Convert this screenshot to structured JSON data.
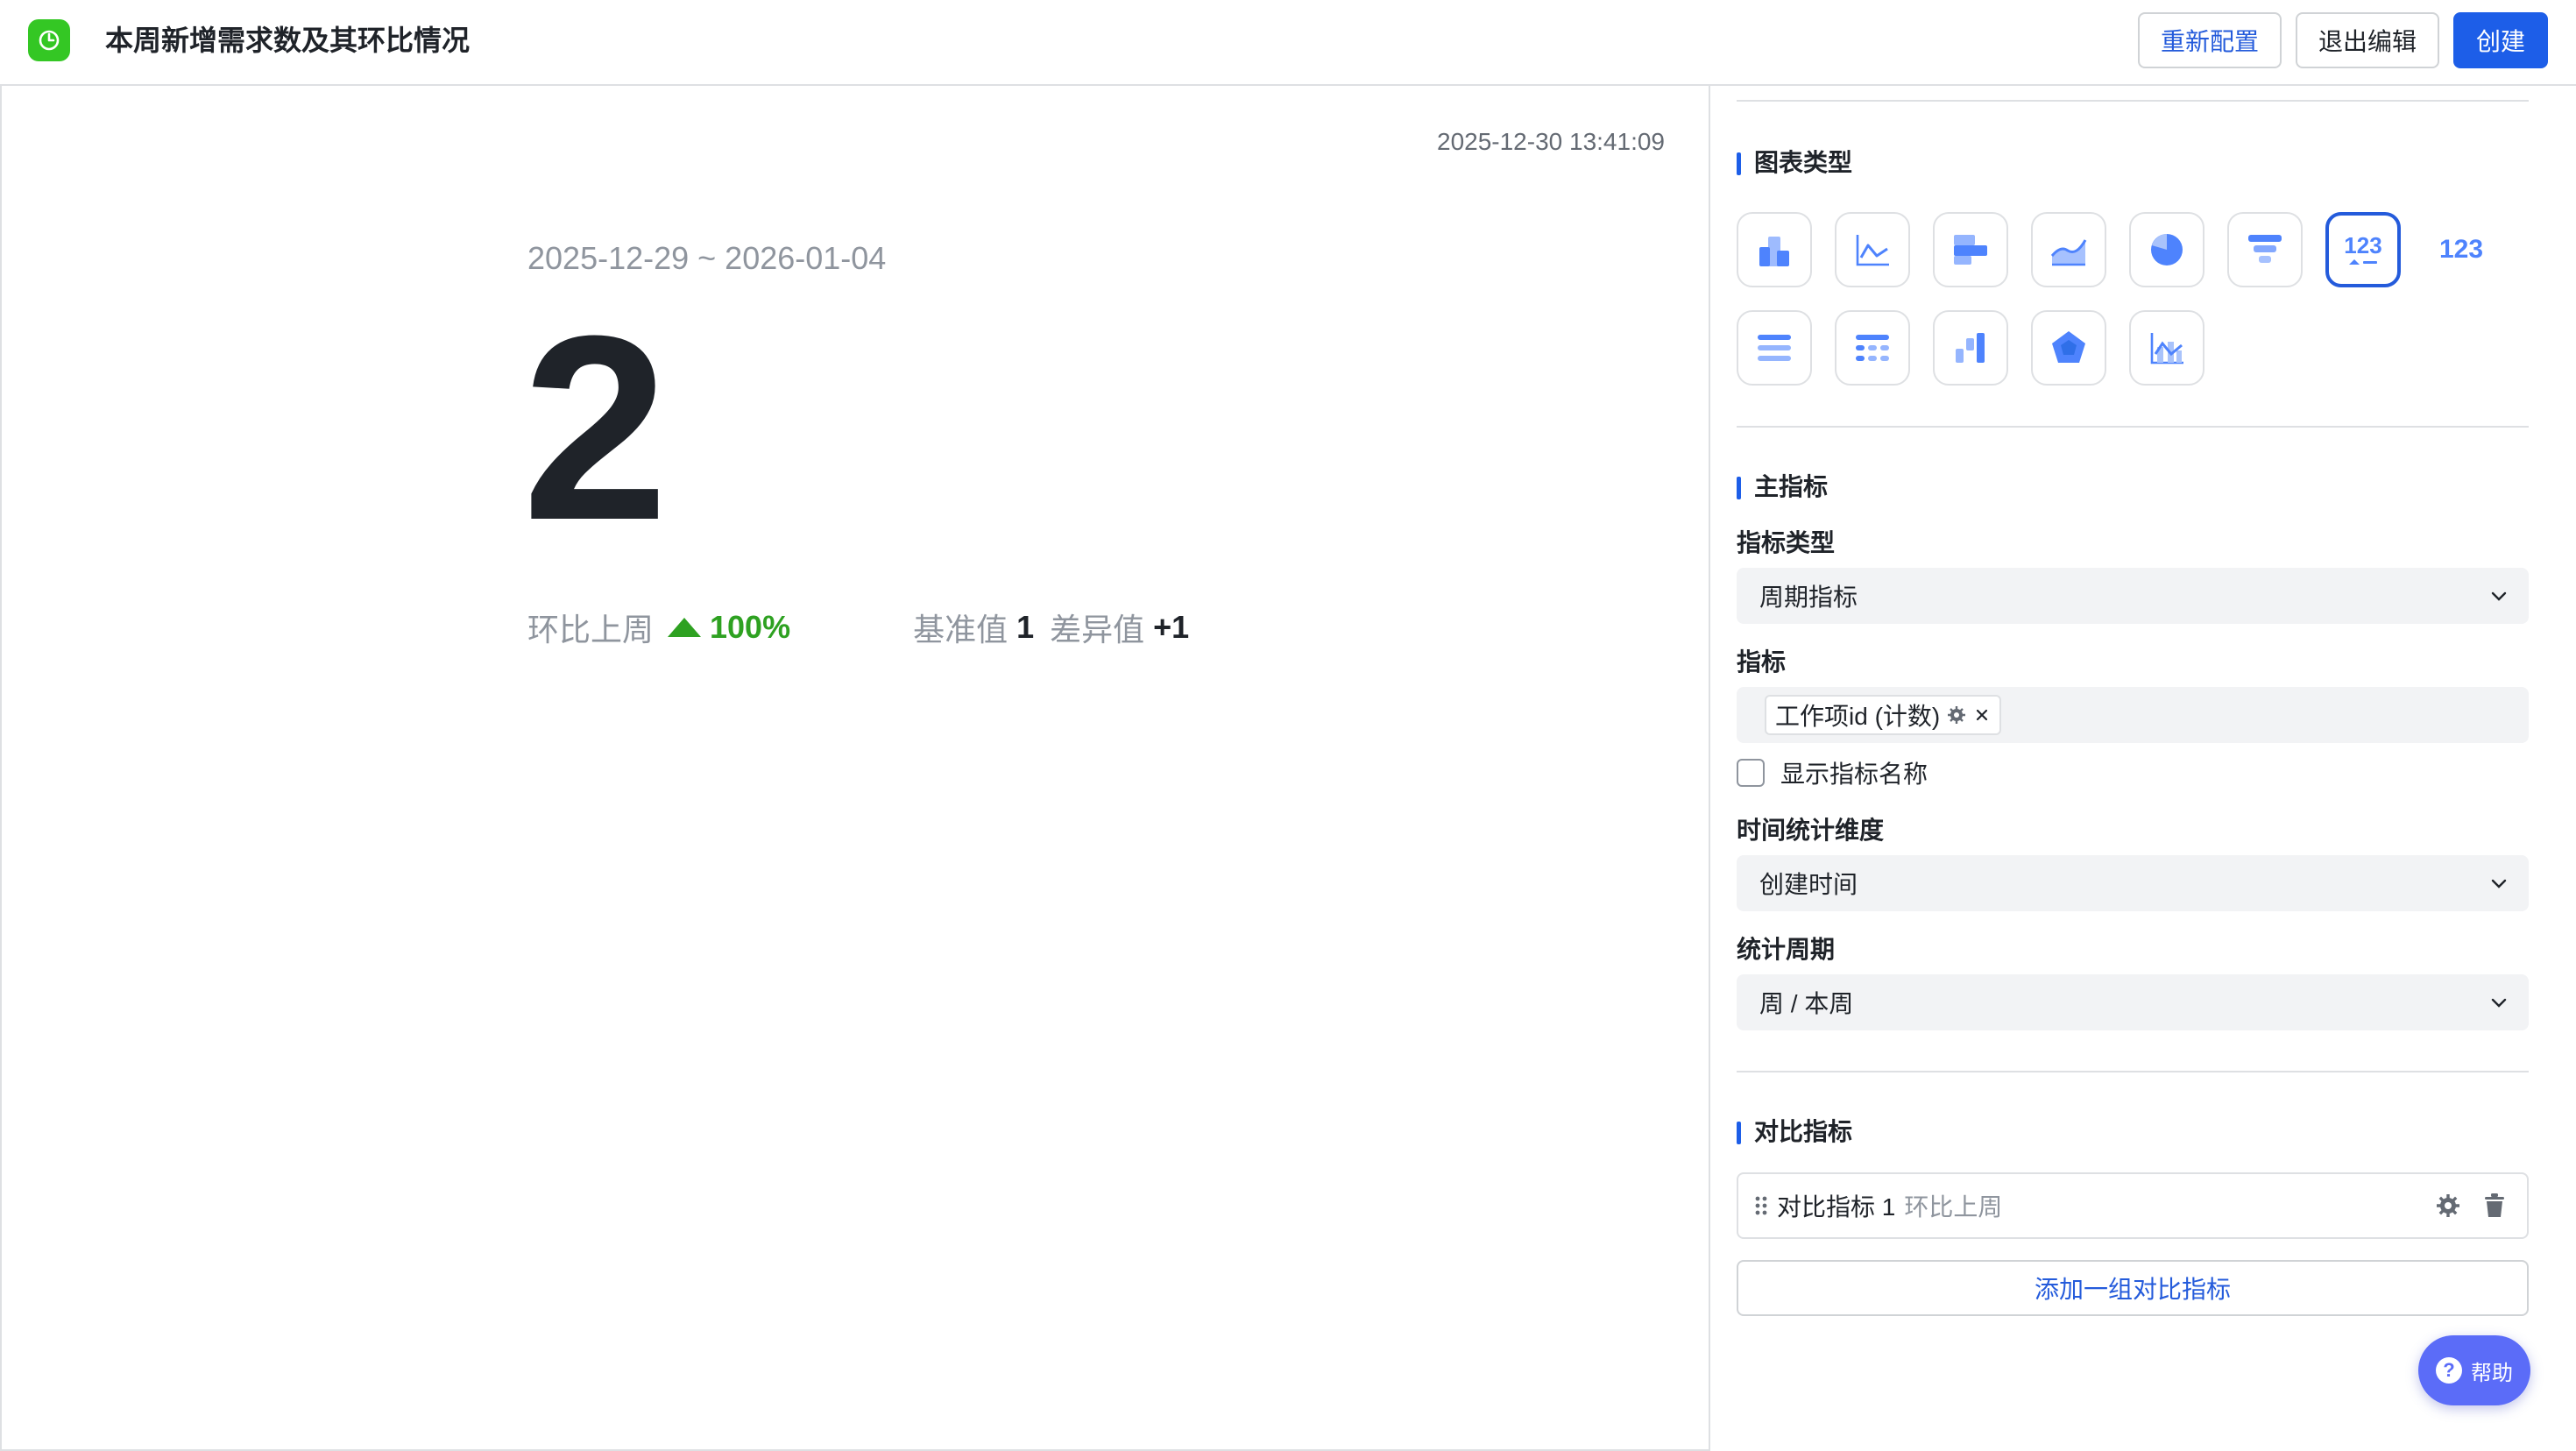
{
  "header": {
    "title": "本周新增需求数及其环比情况",
    "reconfigure_label": "重新配置",
    "exit_edit_label": "退出编辑",
    "create_label": "创建"
  },
  "preview": {
    "timestamp": "2025-12-30 13:41:09",
    "date_range": "2025-12-29 ~ 2026-01-04",
    "value": "2",
    "compare_label": "环比上周",
    "change": "100%",
    "base_label": "基准值",
    "base_value": "1",
    "diff_label": "差异值",
    "diff_value": "+1",
    "colors": {
      "up": "#2ea121",
      "text": "#1f2329",
      "muted": "#8f959e"
    }
  },
  "panel": {
    "chart_type_title": "图表类型",
    "chart_types": [
      {
        "name": "column",
        "icon": "column-chart-icon"
      },
      {
        "name": "line",
        "icon": "line-chart-icon"
      },
      {
        "name": "bar",
        "icon": "bar-chart-icon"
      },
      {
        "name": "area",
        "icon": "area-chart-icon"
      },
      {
        "name": "pie",
        "icon": "pie-chart-icon"
      },
      {
        "name": "funnel",
        "icon": "funnel-chart-icon"
      },
      {
        "name": "indicator-card",
        "icon": "indicator-card-icon",
        "label": "123",
        "active": true
      },
      {
        "name": "number",
        "icon": "number-chart-icon",
        "label": "123"
      },
      {
        "name": "detail-table",
        "icon": "detail-table-icon"
      },
      {
        "name": "pivot-table",
        "icon": "pivot-table-icon"
      },
      {
        "name": "waterfall",
        "icon": "waterfall-chart-icon"
      },
      {
        "name": "radar",
        "icon": "radar-chart-icon"
      },
      {
        "name": "combo",
        "icon": "combo-chart-icon"
      }
    ],
    "main_metric_title": "主指标",
    "metric_type_label": "指标类型",
    "metric_type_value": "周期指标",
    "metric_label": "指标",
    "metric_tag": "工作项id (计数)",
    "show_metric_name_label": "显示指标名称",
    "time_dimension_label": "时间统计维度",
    "time_dimension_value": "创建时间",
    "period_label": "统计周期",
    "period_value": "周 / 本周",
    "compare_title": "对比指标",
    "compare_item_name": "对比指标 1",
    "compare_item_sub": "环比上周",
    "add_compare_label": "添加一组对比指标",
    "help_label": "帮助",
    "accent": "#1d5ee8"
  }
}
